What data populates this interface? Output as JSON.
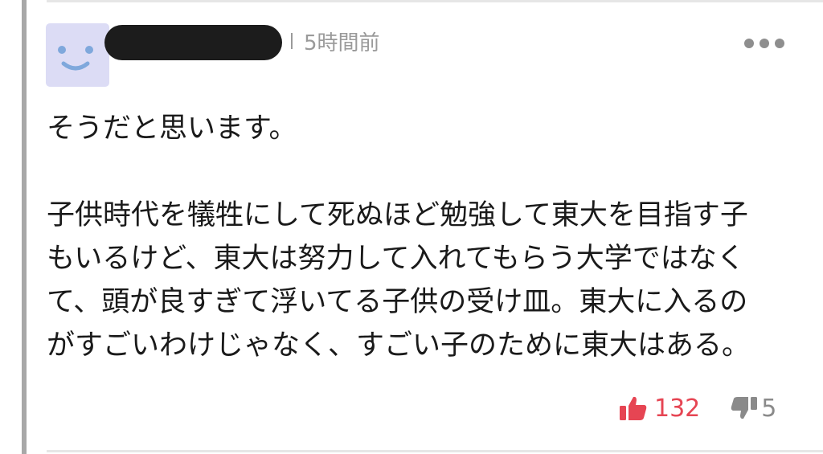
{
  "comment": {
    "author_redacted": true,
    "timestamp": "5時間前",
    "avatar_icon": "smiley-face-icon",
    "more_icon": "more-dots-icon",
    "body": {
      "line1": "そうだと思います。",
      "line2": "子供時代を犠牲にして死ぬほど勉強して東大を目指す子",
      "line3": "もいるけど、東大は努力して入れてもらう大学ではなく",
      "line4": "て、頭が良すぎて浮いてる子供の受け皿。東大に入るの",
      "line5": "がすごいわけじゃなく、すごい子のために東大はある。"
    },
    "likes": "132",
    "dislikes": "5",
    "like_icon": "thumbs-up-icon",
    "dislike_icon": "thumbs-down-icon"
  },
  "colors": {
    "like": "#e64553",
    "dislike": "#8a8a8a",
    "meta": "#9a9a9a",
    "avatar_bg": "#dcdcf5",
    "avatar_face": "#7fa8dc",
    "text": "#1a1a1a",
    "left_rule": "#a8a8a8"
  }
}
